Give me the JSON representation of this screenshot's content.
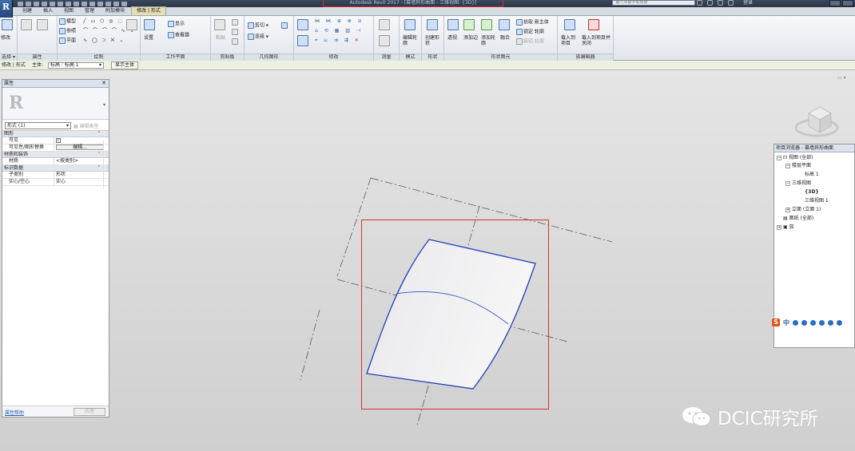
{
  "titlebar": {
    "app_letter": "R",
    "window_title": "Autodesk Revit 2017 - [幕墙异形曲面 - 三维视图: {3D}]",
    "search_placeholder": "键入关键字或短语",
    "login": "登录"
  },
  "tabs": [
    {
      "label": "创建"
    },
    {
      "label": "插入"
    },
    {
      "label": "视图"
    },
    {
      "label": "管理"
    },
    {
      "label": "附加模块"
    },
    {
      "label": "修改 | 形式"
    }
  ],
  "ribbon": {
    "select": {
      "button": "修改",
      "label": "选择 ▾"
    },
    "properties": {
      "label": "属性"
    },
    "draw": {
      "model": "模型",
      "reference": "参照",
      "plane": "平面",
      "label": "绘制"
    },
    "work_plane": {
      "set": "设置",
      "show": "显示",
      "viewer": "查看器",
      "label": "工作平面"
    },
    "clipboard": {
      "paste": "粘贴",
      "label": "剪贴板"
    },
    "geometry": {
      "cut": "剪切",
      "join": "连接",
      "label": "几何图形"
    },
    "modify": {
      "label": "修改"
    },
    "measure": {
      "label": "测量"
    },
    "mode": {
      "edit_profile": "编辑轮廓",
      "label": "模式"
    },
    "form": {
      "create_form": "创建形状",
      "label": "形状"
    },
    "form_element": {
      "xray": "透视",
      "add_edge": "添加边",
      "add_profile": "添加轮廓",
      "blend": "融合",
      "pick_new_host": "拾取 新主体",
      "lock_profile": "锁定 轮廓",
      "unlock_profile": "解锁 轮廓",
      "label": "形状图元"
    },
    "family_editor": {
      "load_into_project": "载入到项目",
      "load_and_close": "载入到项目并关闭",
      "label": "族编辑器"
    }
  },
  "options_bar": {
    "mode": "修改 | 形式",
    "host_label": "主体:",
    "host_value": "标高 : 标高 1",
    "show_host": "显示主体"
  },
  "properties": {
    "title": "属性",
    "type_selector": "形式 (1)",
    "edit_type": "编辑类型",
    "sections": [
      {
        "name": "图形",
        "rows": [
          {
            "key": "可见",
            "value": "✓"
          },
          {
            "key": "可见性/图形替换",
            "value": "编辑..."
          }
        ]
      },
      {
        "name": "材质和装饰",
        "rows": [
          {
            "key": "材质",
            "value": "<按类别>"
          }
        ]
      },
      {
        "name": "标识数据",
        "rows": [
          {
            "key": "子类别",
            "value": "形状"
          },
          {
            "key": "实心/空心",
            "value": "实心"
          }
        ]
      }
    ],
    "help_link": "属性帮助",
    "apply": "应用"
  },
  "browser": {
    "title": "项目浏览器 - 幕墙异形曲面",
    "items": [
      {
        "label": "视图 (全部)"
      },
      {
        "label": "楼层平面"
      },
      {
        "label": "标高 1"
      },
      {
        "label": "三维视图"
      },
      {
        "label": "{3D}"
      },
      {
        "label": "三维视图 1"
      },
      {
        "label": "立面 (立面 1)"
      },
      {
        "label": "图纸 (全部)"
      },
      {
        "label": "族"
      }
    ]
  },
  "ime": {
    "s": "S",
    "zh": "中"
  },
  "watermark": {
    "text": "DCIC研究所"
  },
  "colors": {
    "selection": "#d93030",
    "surface_edge": "#1f3fb8",
    "ref_line": "#555566",
    "accent": "#2a5db0"
  }
}
